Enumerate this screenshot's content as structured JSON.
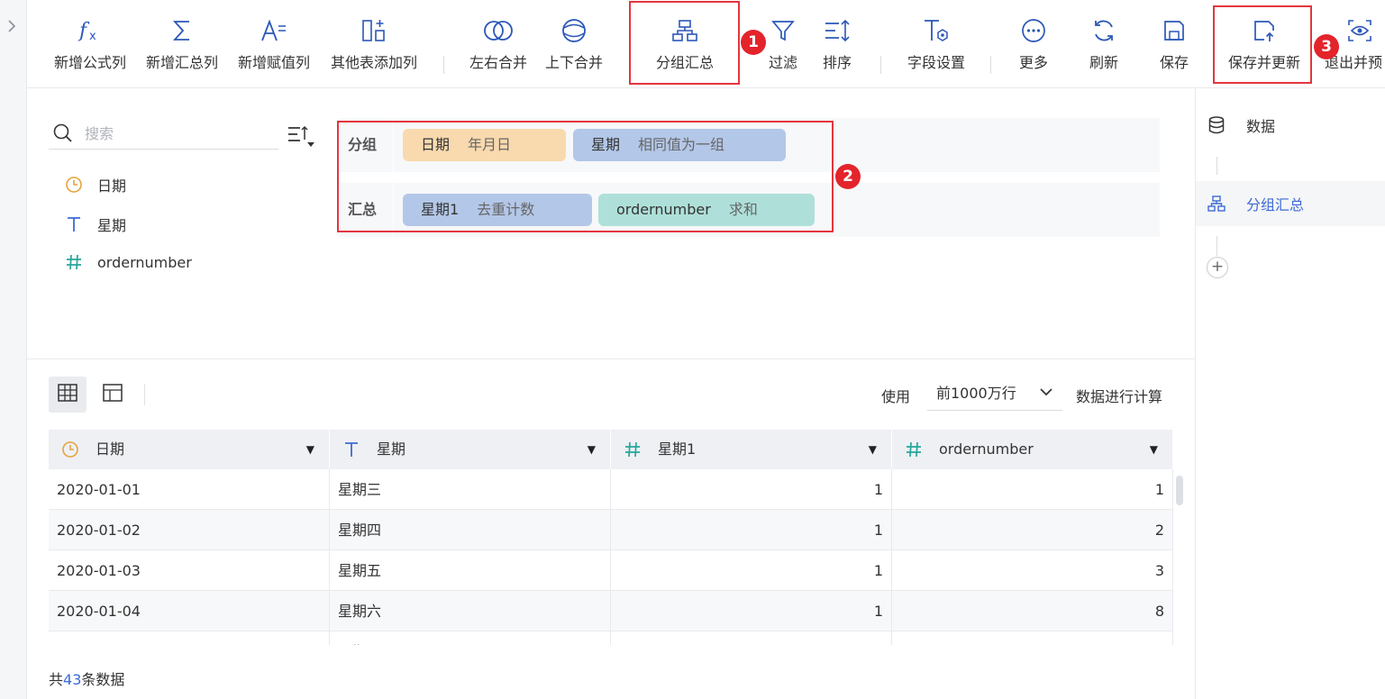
{
  "toolbar": {
    "add_formula": "新增公式列",
    "add_summary": "新增汇总列",
    "add_assign": "新增赋值列",
    "add_from_other": "其他表添加列",
    "merge_lr": "左右合并",
    "merge_tb": "上下合并",
    "group_summary": "分组汇总",
    "filter": "过滤",
    "sort": "排序",
    "field_settings": "字段设置",
    "more": "更多",
    "refresh": "刷新",
    "save": "保存",
    "save_update": "保存并更新",
    "exit_preview": "退出并预"
  },
  "badges": {
    "b1": "1",
    "b2": "2",
    "b3": "3"
  },
  "fields_panel": {
    "search_placeholder": "搜索",
    "fields": [
      {
        "name": "日期",
        "type": "date"
      },
      {
        "name": "星期",
        "type": "text"
      },
      {
        "name": "ordernumber",
        "type": "number"
      }
    ]
  },
  "group_panel": {
    "group_label": "分组",
    "summary_label": "汇总",
    "group_chips": [
      {
        "name": "日期",
        "mode": "年月日",
        "color": "#f9d9ae"
      },
      {
        "name": "星期",
        "mode": "相同值为一组",
        "color": "#b3c7e8"
      }
    ],
    "summary_chips": [
      {
        "name": "星期1",
        "mode": "去重计数",
        "color": "#b3c7e8"
      },
      {
        "name": "ordernumber",
        "mode": "求和",
        "color": "#aee0d9"
      }
    ]
  },
  "table_controls": {
    "use_label": "使用",
    "rows_option": "前1000万行",
    "calc_label": "数据进行计算"
  },
  "table": {
    "columns": [
      {
        "name": "日期",
        "type": "date"
      },
      {
        "name": "星期",
        "type": "text"
      },
      {
        "name": "星期1",
        "type": "number"
      },
      {
        "name": "ordernumber",
        "type": "number"
      }
    ],
    "rows": [
      [
        "2020-01-01",
        "星期三",
        "1",
        "1"
      ],
      [
        "2020-01-02",
        "星期四",
        "1",
        "2"
      ],
      [
        "2020-01-03",
        "星期五",
        "1",
        "3"
      ],
      [
        "2020-01-04",
        "星期六",
        "1",
        "8"
      ],
      [
        "",
        "星期日",
        "",
        ""
      ]
    ]
  },
  "footer": {
    "prefix": "共",
    "count": "43",
    "suffix": "条数据"
  },
  "right_panel": {
    "data_label": "数据",
    "step_label": "分组汇总"
  },
  "colors": {
    "accent": "#3d6ad6",
    "highlight": "#e3363e",
    "date_icon": "#e6a23c",
    "number_icon": "#26a69a"
  }
}
